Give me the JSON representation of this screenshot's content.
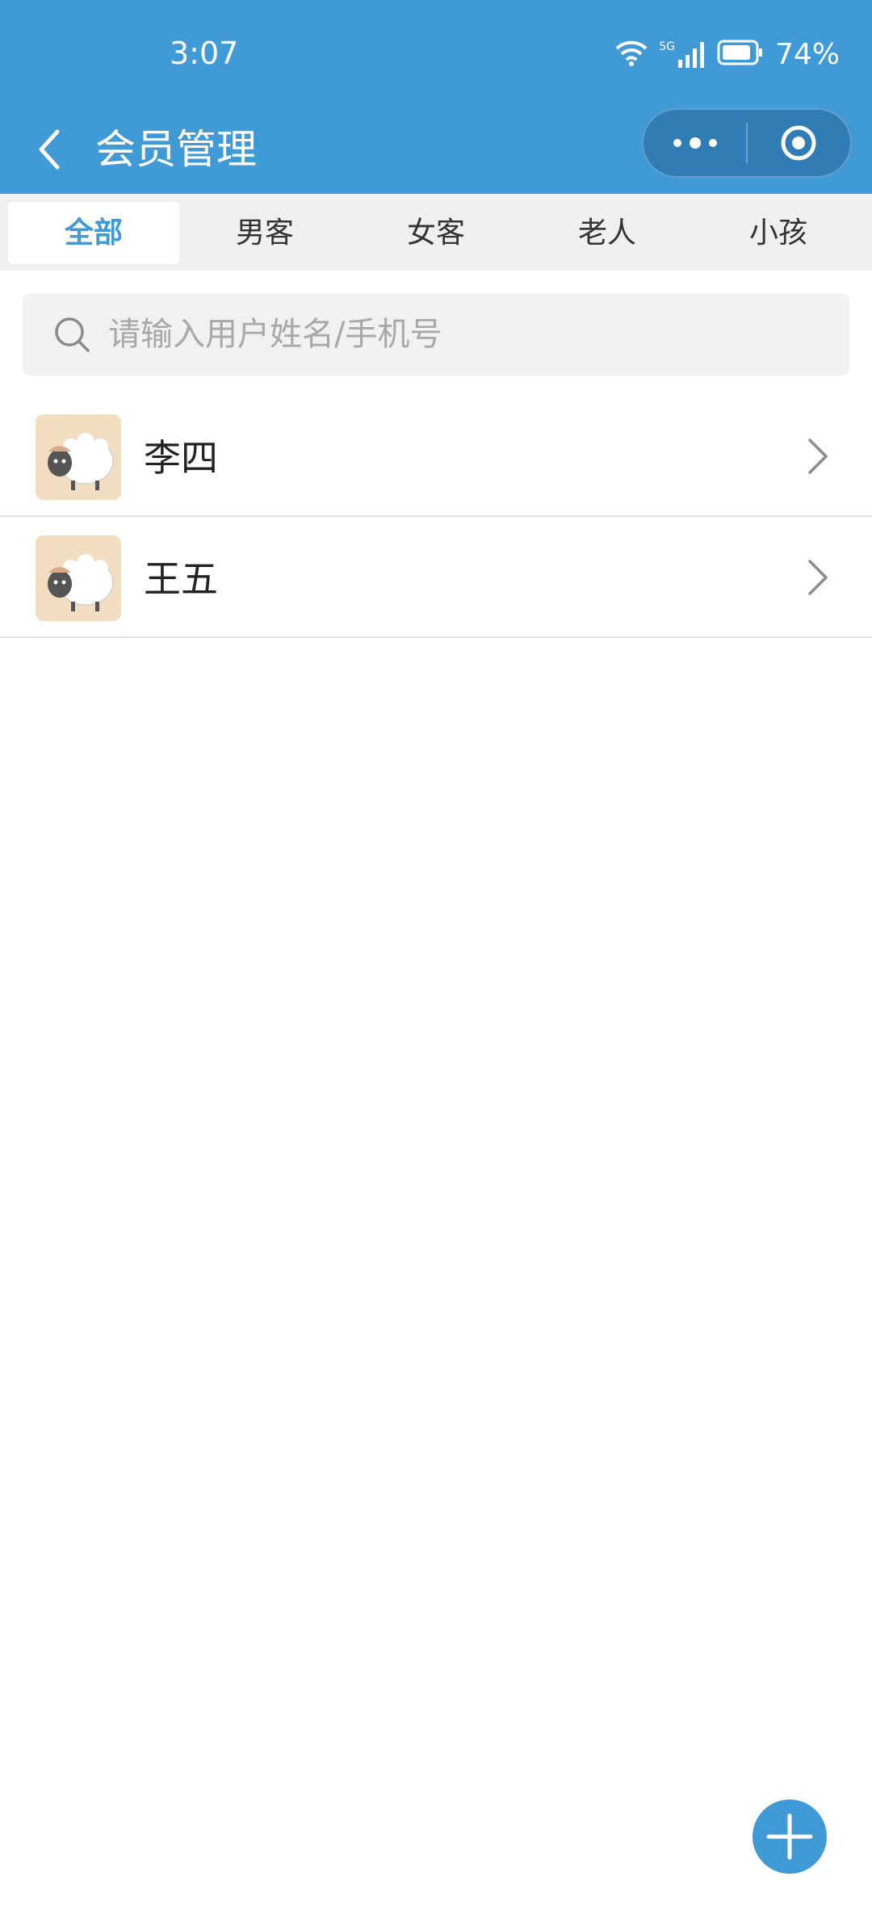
{
  "status_bar": {
    "time": "3:07",
    "network": "5G",
    "battery": "74%"
  },
  "nav": {
    "title": "会员管理",
    "back_icon": "chevron-left-icon",
    "more_icon": "more-dots-icon",
    "close_icon": "target-circle-icon"
  },
  "tabs": [
    {
      "label": "全部",
      "active": true
    },
    {
      "label": "男客",
      "active": false
    },
    {
      "label": "女客",
      "active": false
    },
    {
      "label": "老人",
      "active": false
    },
    {
      "label": "小孩",
      "active": false
    }
  ],
  "search": {
    "placeholder": "请输入用户姓名/手机号",
    "value": ""
  },
  "members": [
    {
      "name": "李四",
      "avatar": "sheep-avatar"
    },
    {
      "name": "王五",
      "avatar": "sheep-avatar"
    }
  ],
  "fab": {
    "icon": "plus-icon"
  },
  "colors": {
    "primary": "#409ad6",
    "tab_bar_bg": "#efefef",
    "avatar_bg": "#f3ddc0"
  }
}
